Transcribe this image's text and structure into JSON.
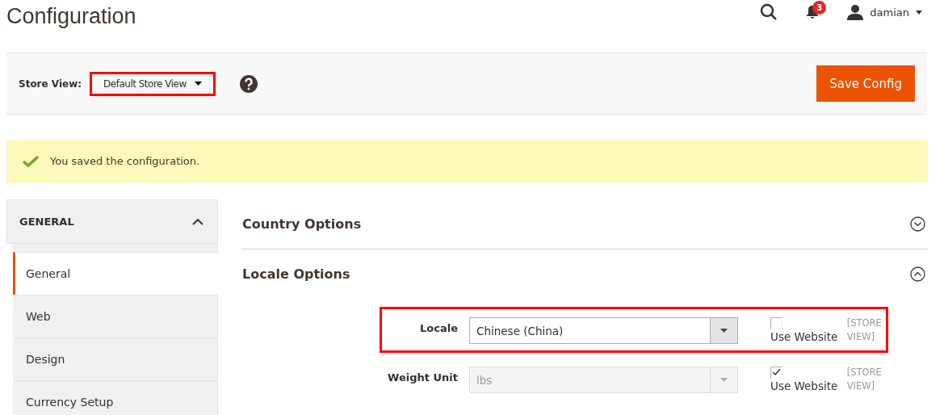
{
  "page_title": "Configuration",
  "header": {
    "notifications": "3",
    "user": "damian"
  },
  "store_view": {
    "label": "Store View:",
    "value": "Default Store View",
    "highlighted": true
  },
  "save_button": "Save Config",
  "message": {
    "kind": "success",
    "text": "You saved the configuration."
  },
  "sidebar": {
    "title": "GENERAL",
    "expanded": true,
    "items": [
      {
        "label": "General",
        "selected": true
      },
      {
        "label": "Web",
        "selected": false
      },
      {
        "label": "Design",
        "selected": false
      },
      {
        "label": "Currency Setup",
        "selected": false
      }
    ]
  },
  "sections": [
    {
      "title": "Country Options",
      "expanded": false
    },
    {
      "title": "Locale Options",
      "expanded": true,
      "fields": [
        {
          "label": "Locale",
          "value": "Chinese (China)",
          "disabled": false,
          "use_website": "Use Website",
          "checked": false,
          "scope": "[STORE VIEW]",
          "highlighted": true
        },
        {
          "label": "Weight Unit",
          "value": "lbs",
          "disabled": true,
          "use_website": "Use Website",
          "checked": true,
          "scope": "[STORE VIEW]",
          "highlighted": false
        }
      ]
    }
  ]
}
